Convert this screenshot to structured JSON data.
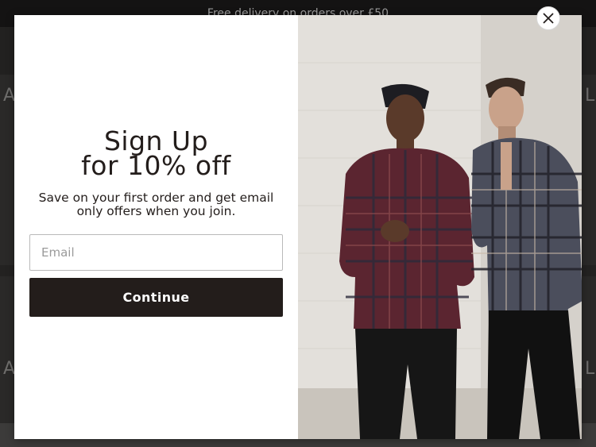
{
  "promo": {
    "text": "Free delivery on orders over £50"
  },
  "background": {
    "letters": [
      "A",
      "L",
      "A",
      "L"
    ]
  },
  "modal": {
    "title_line1": "Sign Up",
    "title_line2": "for 10% off",
    "subtitle": "Save on your first order and get email only offers when you join.",
    "email_placeholder": "Email",
    "email_value": "",
    "continue_label": "Continue",
    "close_icon": "close-icon",
    "colors": {
      "button_bg": "#231d1b",
      "text": "#231d1b",
      "overlay": "#2a2928"
    }
  },
  "photo": {
    "subject": "two-men-in-plaid-shirts"
  }
}
